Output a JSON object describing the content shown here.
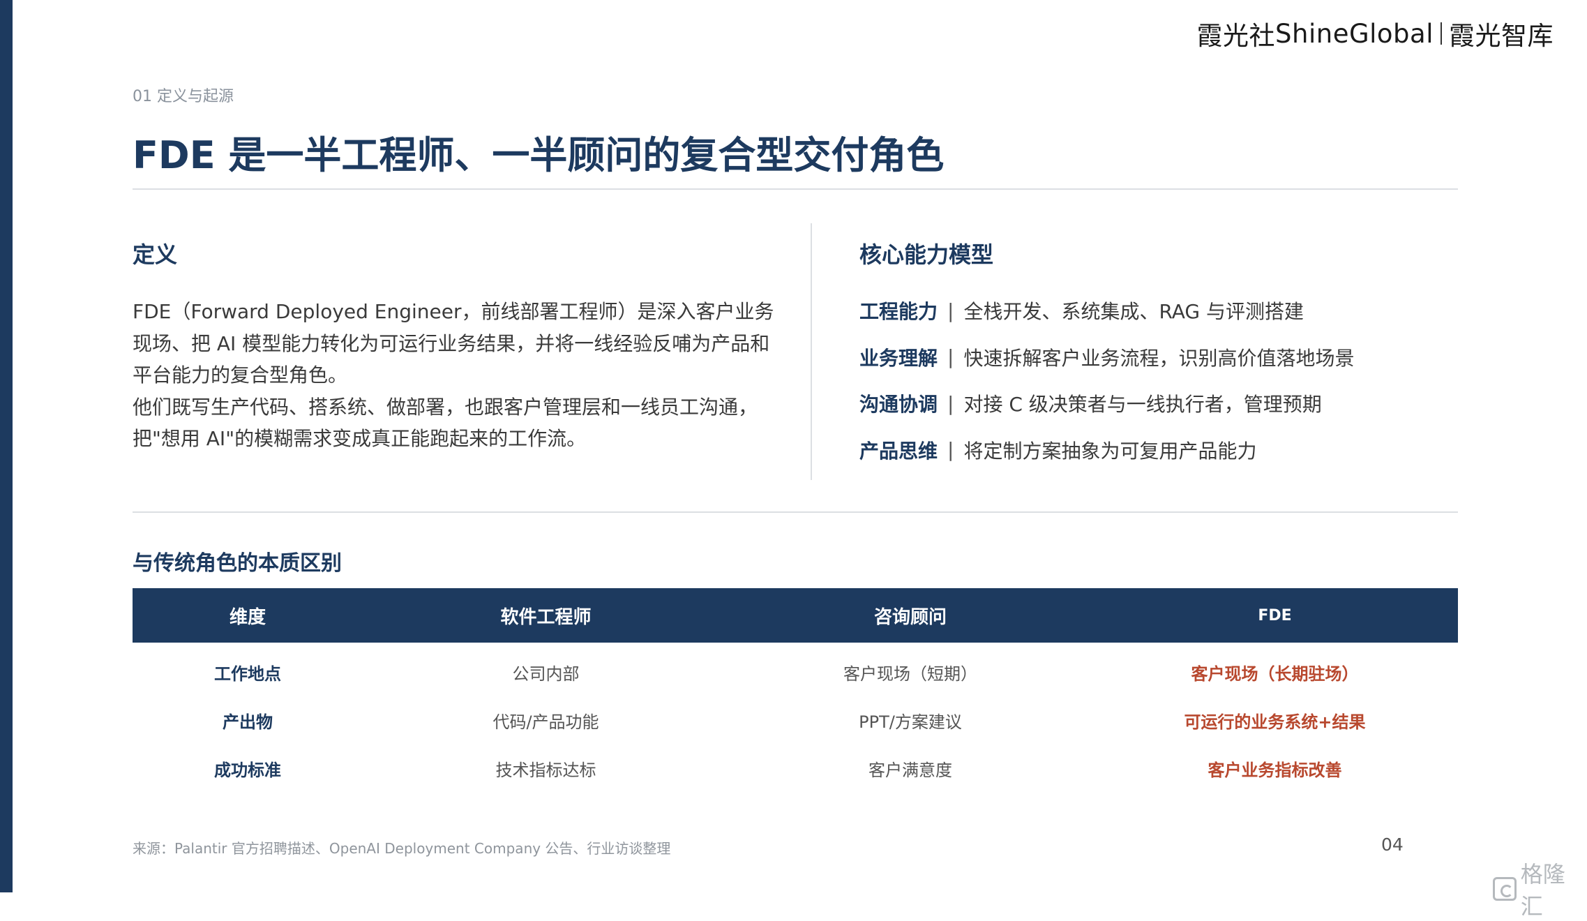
{
  "brand": {
    "name1": "霞光社",
    "name2": "ShineGlobal",
    "name3": "霞光智库"
  },
  "header": {
    "section_label": "01 定义与起源",
    "title": "FDE 是一半工程师、一半顾问的复合型交付角色"
  },
  "definition": {
    "heading": "定义",
    "paragraphs": [
      "FDE（Forward Deployed Engineer，前线部署工程师）是深入客户业务现场、把 AI 模型能力转化为可运行业务结果，并将一线经验反哺为产品和平台能力的复合型角色。",
      "他们既写生产代码、搭系统、做部署，也跟客户管理层和一线员工沟通，把\"想用 AI\"的模糊需求变成真正能跑起来的工作流。"
    ]
  },
  "core_model": {
    "heading": "核心能力模型",
    "separator": "|",
    "items": [
      {
        "name": "工程能力",
        "desc": "全栈开发、系统集成、RAG 与评测搭建"
      },
      {
        "name": "业务理解",
        "desc": "快速拆解客户业务流程，识别高价值落地场景"
      },
      {
        "name": "沟通协调",
        "desc": "对接 C 级决策者与一线执行者，管理预期"
      },
      {
        "name": "产品思维",
        "desc": "将定制方案抽象为可复用产品能力"
      }
    ]
  },
  "comparison": {
    "heading": "与传统角色的本质区别",
    "columns": [
      "维度",
      "软件工程师",
      "咨询顾问",
      "FDE"
    ],
    "rows": [
      [
        "工作地点",
        "公司内部",
        "客户现场（短期）",
        "客户现场（长期驻场）"
      ],
      [
        "产出物",
        "代码/产品功能",
        "PPT/方案建议",
        "可运行的业务系统+结果"
      ],
      [
        "成功标准",
        "技术指标达标",
        "客户满意度",
        "客户业务指标改善"
      ]
    ]
  },
  "footer": {
    "source": "来源：Palantir 官方招聘描述、OpenAI Deployment Company 公告、行业访谈整理",
    "page_number": "04"
  },
  "watermark": {
    "text": "格隆汇"
  },
  "colors": {
    "primary": "#1d3a5f",
    "accent": "#b8482e",
    "muted": "#8a929c",
    "divider": "#dcdfe3"
  },
  "icons": {
    "watermark": "gelonghui-logo-icon"
  }
}
